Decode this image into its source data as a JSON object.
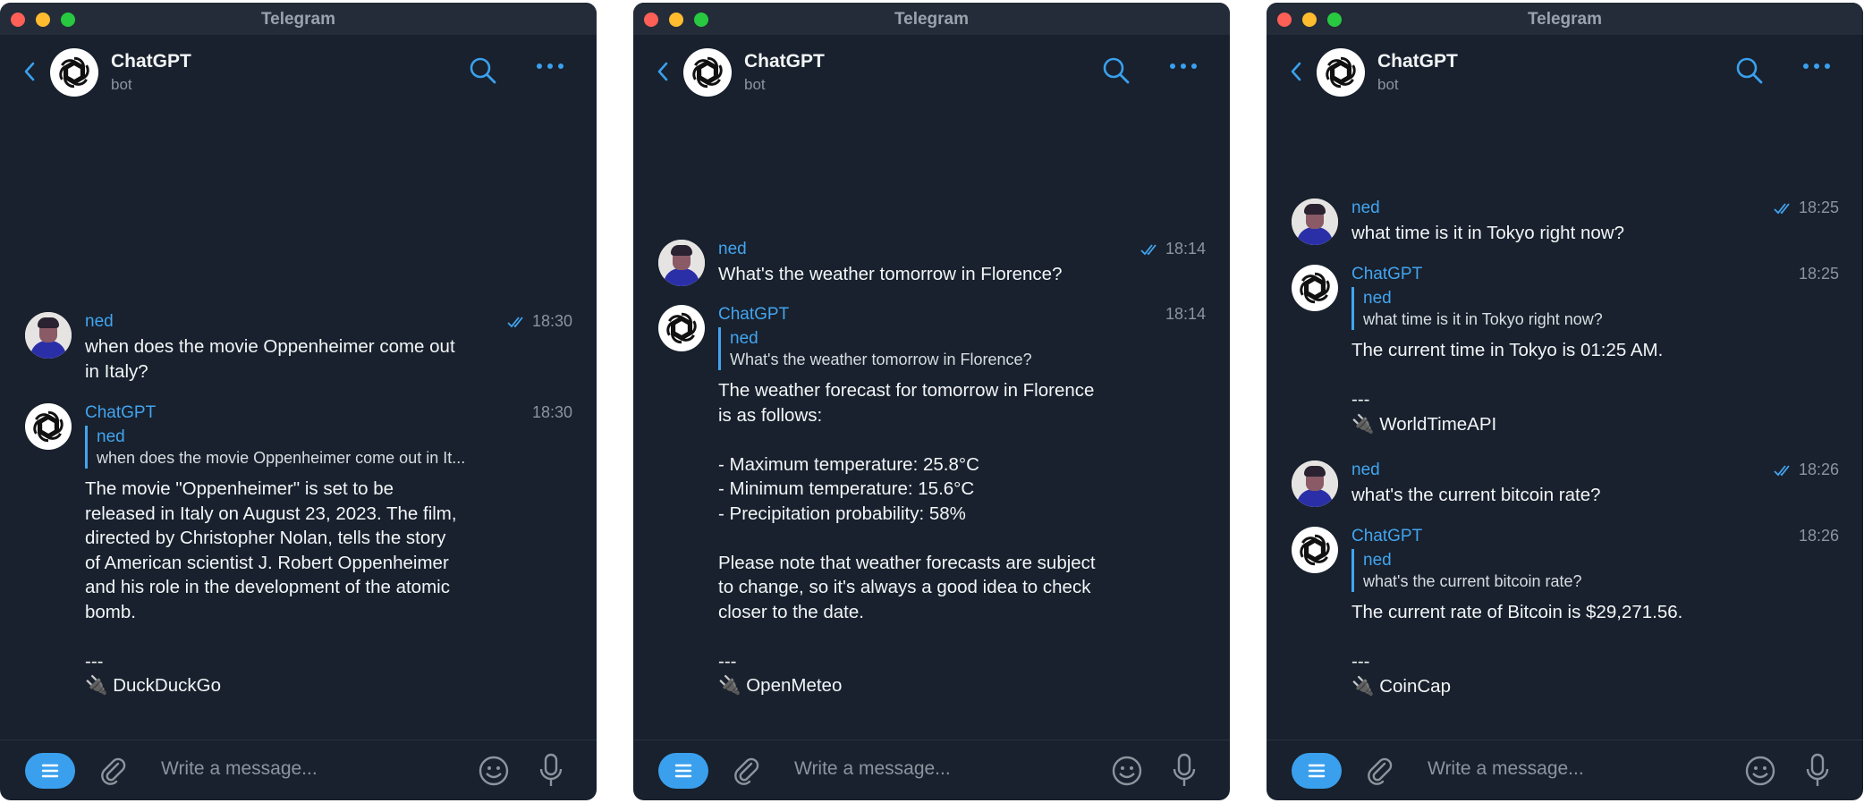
{
  "windows": [
    {
      "title": "Telegram",
      "chat": {
        "name": "ChatGPT",
        "subtitle": "bot"
      },
      "composer": {
        "placeholder": "Write a message..."
      },
      "messages": [
        {
          "sender": "ned",
          "time": "18:30",
          "text": "when does the movie Oppenheimer come out\nin Italy?"
        },
        {
          "sender": "ChatGPT",
          "time": "18:30",
          "reply_to": "ned",
          "reply_text": "when does the movie Oppenheimer come out in It...",
          "text": "The movie \"Oppenheimer\" is set to be\nreleased in Italy on August 23, 2023. The film,\ndirected by Christopher Nolan, tells the story\nof American scientist J. Robert Oppenheimer\nand his role in the development of the atomic\nbomb.\n\n---\n🔌 DuckDuckGo"
        }
      ]
    },
    {
      "title": "Telegram",
      "chat": {
        "name": "ChatGPT",
        "subtitle": "bot"
      },
      "composer": {
        "placeholder": "Write a message..."
      },
      "messages": [
        {
          "sender": "ned",
          "time": "18:14",
          "text": "What's the weather tomorrow in Florence?"
        },
        {
          "sender": "ChatGPT",
          "time": "18:14",
          "reply_to": "ned",
          "reply_text": "What's the weather tomorrow in Florence?",
          "text": "The weather forecast for tomorrow in Florence\nis as follows:\n\n- Maximum temperature: 25.8°C\n- Minimum temperature: 15.6°C\n- Precipitation probability: 58%\n\nPlease note that weather forecasts are subject\nto change, so it's always a good idea to check\ncloser to the date.\n\n---\n🔌 OpenMeteo"
        }
      ]
    },
    {
      "title": "Telegram",
      "chat": {
        "name": "ChatGPT",
        "subtitle": "bot"
      },
      "composer": {
        "placeholder": "Write a message..."
      },
      "messages": [
        {
          "sender": "ned",
          "time": "18:25",
          "text": "what time is it in Tokyo right now?"
        },
        {
          "sender": "ChatGPT",
          "time": "18:25",
          "reply_to": "ned",
          "reply_text": "what time is it in Tokyo right now?",
          "text": "The current time in Tokyo is 01:25 AM.\n\n---\n🔌 WorldTimeAPI"
        },
        {
          "sender": "ned",
          "time": "18:26",
          "text": "what's the current bitcoin rate?"
        },
        {
          "sender": "ChatGPT",
          "time": "18:26",
          "reply_to": "ned",
          "reply_text": "what's the current bitcoin rate?",
          "text": "The current rate of Bitcoin is $29,271.56.\n\n---\n🔌 CoinCap"
        }
      ]
    }
  ]
}
